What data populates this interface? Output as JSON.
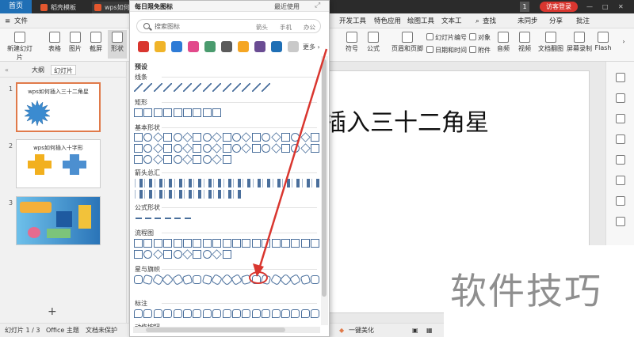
{
  "titlebar": {
    "home": "首页",
    "tabs": [
      {
        "label": "稻壳模板",
        "color": "#e4572e"
      },
      {
        "label": "wps如何插",
        "color": "#e4572e"
      }
    ],
    "badge": "1",
    "login": "访客登录"
  },
  "ribbon_tabs": {
    "file": "文件",
    "items": [
      "开发工具",
      "特色应用",
      "绘图工具",
      "文本工"
    ],
    "search": "查找",
    "sync": "未同步",
    "share": "分享",
    "comment": "批注"
  },
  "ribbon": {
    "new_slide": "新建幻灯片",
    "table": "表格",
    "image": "图片",
    "screenshot": "截屏",
    "shapes": "形状",
    "symbol": "符号",
    "formula": "公式",
    "header_footer": "页眉和页脚",
    "slide_number": "幻灯片编号",
    "object": "对象",
    "datetime": "日期和时间",
    "attachment": "附件",
    "audio": "音频",
    "video": "视频",
    "doc_to_slide": "文档翻图",
    "screen_record": "屏幕录制",
    "flash": "Flash"
  },
  "left_panel": {
    "tab_outline": "大纲",
    "tab_slides": "幻灯片",
    "slides": [
      {
        "num": "1",
        "title": "wps如何插入三十二角星"
      },
      {
        "num": "2",
        "title": "wps如何插入十字形"
      },
      {
        "num": "3",
        "title": ""
      }
    ]
  },
  "slide": {
    "title": "插入三十二角星"
  },
  "dropdown": {
    "title": "每日限免图标",
    "link": "最近使用",
    "search_placeholder": "搜索图标",
    "keywords": [
      "箭头",
      "手机",
      "办公"
    ],
    "more": "更多",
    "sections": [
      "预设",
      "线条",
      "矩形",
      "基本形状",
      "箭头总汇",
      "公式形状",
      "流程图",
      "星与旗帜",
      "标注",
      "动作按钮"
    ],
    "stock_icon_colors": [
      "#d9362f",
      "#f0b429",
      "#2e7bd6",
      "#e24a8b",
      "#4a9b6e",
      "#5b5b5b",
      "#f5a623",
      "#6a4c93",
      "#1f6fb5",
      "#c9c9c9"
    ]
  },
  "status": {
    "slide_info": "幻灯片 1 / 3",
    "theme": "Office 主题",
    "protect": "文档未保护",
    "beautify": "一键美化"
  },
  "watermark": "软件技巧",
  "colors": {
    "accent_orange": "#e07a4a",
    "arrow_red": "#d9362f",
    "shape_blue": "#4a6f9c"
  }
}
